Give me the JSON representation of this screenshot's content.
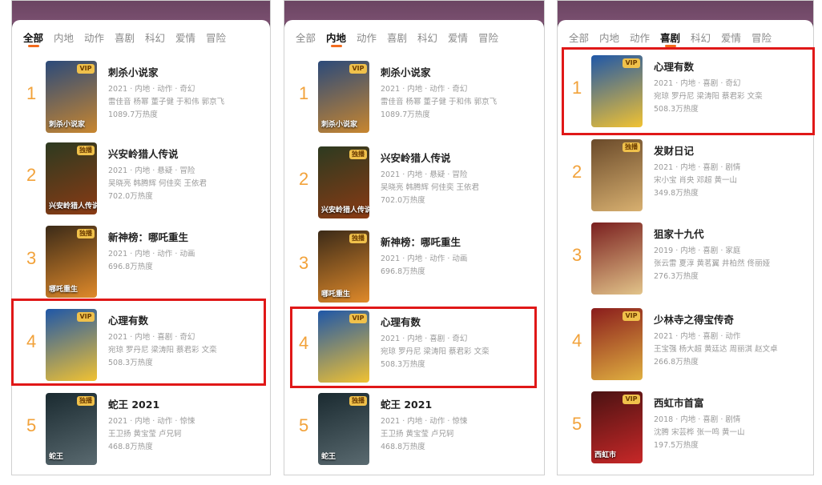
{
  "panels": [
    {
      "tabs": [
        "全部",
        "内地",
        "动作",
        "喜剧",
        "科幻",
        "爱情",
        "冒险"
      ],
      "active_tab": 0,
      "items": [
        {
          "rank": "1",
          "title": "刺杀小说家",
          "meta": "2021 · 内地 · 动作 · 奇幻",
          "cast": "雷佳音 杨幂 董子健 于和伟 郭京飞",
          "heat": "1089.7万热度",
          "badge": "VIP",
          "poster_text": "刺杀小说家",
          "c1": "#2b4a7a",
          "c2": "#c8862f"
        },
        {
          "rank": "2",
          "title": "兴安岭猎人传说",
          "meta": "2021 · 内地 · 悬疑 · 冒险",
          "cast": "吴晓亮 韩腾辉 何佳奕 王依君",
          "heat": "702.0万热度",
          "badge": "独播",
          "poster_text": "兴安岭猎人传说",
          "c1": "#2d3a20",
          "c2": "#8a3a14"
        },
        {
          "rank": "3",
          "title": "新神榜：哪吒重生",
          "meta": "2021 · 内地 · 动作 · 动画",
          "cast": "",
          "heat": "696.8万热度",
          "badge": "独播",
          "poster_text": "哪吒重生",
          "c1": "#3b2a18",
          "c2": "#e08a2a"
        },
        {
          "rank": "4",
          "title": "心理有数",
          "meta": "2021 · 内地 · 喜剧 · 奇幻",
          "cast": "宛琼 罗丹尼 梁涛阳 蔡君彩 文栾",
          "heat": "508.3万热度",
          "badge": "VIP",
          "poster_text": "",
          "c1": "#1f57a8",
          "c2": "#f1c232"
        },
        {
          "rank": "5",
          "title": "蛇王 2021",
          "meta": "2021 · 内地 · 动作 · 惊悚",
          "cast": "王卫扬 黄宝莹 卢兄轲",
          "heat": "468.8万热度",
          "badge": "独播",
          "poster_text": "蛇王",
          "c1": "#1a2a30",
          "c2": "#5a6a70"
        }
      ]
    },
    {
      "tabs": [
        "全部",
        "内地",
        "动作",
        "喜剧",
        "科幻",
        "爱情",
        "冒险"
      ],
      "active_tab": 1,
      "items": [
        {
          "rank": "1",
          "title": "刺杀小说家",
          "meta": "2021 · 内地 · 动作 · 奇幻",
          "cast": "雷佳音 杨幂 董子健 于和伟 郭京飞",
          "heat": "1089.7万热度",
          "badge": "VIP",
          "poster_text": "刺杀小说家",
          "c1": "#2b4a7a",
          "c2": "#c8862f"
        },
        {
          "rank": "2",
          "title": "兴安岭猎人传说",
          "meta": "2021 · 内地 · 悬疑 · 冒险",
          "cast": "吴晓亮 韩腾辉 何佳奕 王依君",
          "heat": "702.0万热度",
          "badge": "独播",
          "poster_text": "兴安岭猎人传说",
          "c1": "#2d3a20",
          "c2": "#8a3a14"
        },
        {
          "rank": "3",
          "title": "新神榜：哪吒重生",
          "meta": "2021 · 内地 · 动作 · 动画",
          "cast": "",
          "heat": "696.8万热度",
          "badge": "独播",
          "poster_text": "哪吒重生",
          "c1": "#3b2a18",
          "c2": "#e08a2a"
        },
        {
          "rank": "4",
          "title": "心理有数",
          "meta": "2021 · 内地 · 喜剧 · 奇幻",
          "cast": "宛琼 罗丹尼 梁涛阳 蔡君彩 文栾",
          "heat": "508.3万热度",
          "badge": "VIP",
          "poster_text": "",
          "c1": "#1f57a8",
          "c2": "#f1c232"
        },
        {
          "rank": "5",
          "title": "蛇王 2021",
          "meta": "2021 · 内地 · 动作 · 惊悚",
          "cast": "王卫扬 黄宝莹 卢兄轲",
          "heat": "468.8万热度",
          "badge": "独播",
          "poster_text": "蛇王",
          "c1": "#1a2a30",
          "c2": "#5a6a70"
        }
      ]
    },
    {
      "tabs": [
        "全部",
        "内地",
        "动作",
        "喜剧",
        "科幻",
        "爱情",
        "冒险"
      ],
      "active_tab": 3,
      "items": [
        {
          "rank": "1",
          "title": "心理有数",
          "meta": "2021 · 内地 · 喜剧 · 奇幻",
          "cast": "宛琼 罗丹尼 梁涛阳 蔡君彩 文栾",
          "heat": "508.3万热度",
          "badge": "VIP",
          "poster_text": "",
          "c1": "#1f57a8",
          "c2": "#f1c232"
        },
        {
          "rank": "2",
          "title": "发财日记",
          "meta": "2021 · 内地 · 喜剧 · 剧情",
          "cast": "宋小宝 肖央 邓超 黄一山",
          "heat": "349.8万热度",
          "badge": "独播",
          "poster_text": "",
          "c1": "#6a4a2a",
          "c2": "#d8b070"
        },
        {
          "rank": "3",
          "title": "狙家十九代",
          "meta": "2019 · 内地 · 喜剧 · 家庭",
          "cast": "张云雷 夏淳 黄茗翼 井柏然 佟丽娅",
          "heat": "276.3万热度",
          "badge": "",
          "poster_text": "",
          "c1": "#7a1f1f",
          "c2": "#e2c48a"
        },
        {
          "rank": "4",
          "title": "少林寺之得宝传奇",
          "meta": "2021 · 内地 · 喜剧 · 动作",
          "cast": "王宝强 杨大超 黄廷达 周丽淇 赵文卓",
          "heat": "266.8万热度",
          "badge": "VIP",
          "poster_text": "",
          "c1": "#8a1c1c",
          "c2": "#e0b040"
        },
        {
          "rank": "5",
          "title": "西虹市首富",
          "meta": "2018 · 内地 · 喜剧 · 剧情",
          "cast": "沈腾 宋芸桦 张一鸣 黄一山",
          "heat": "197.5万热度",
          "badge": "VIP",
          "poster_text": "西虹市",
          "c1": "#4a1212",
          "c2": "#c82828"
        }
      ]
    }
  ]
}
